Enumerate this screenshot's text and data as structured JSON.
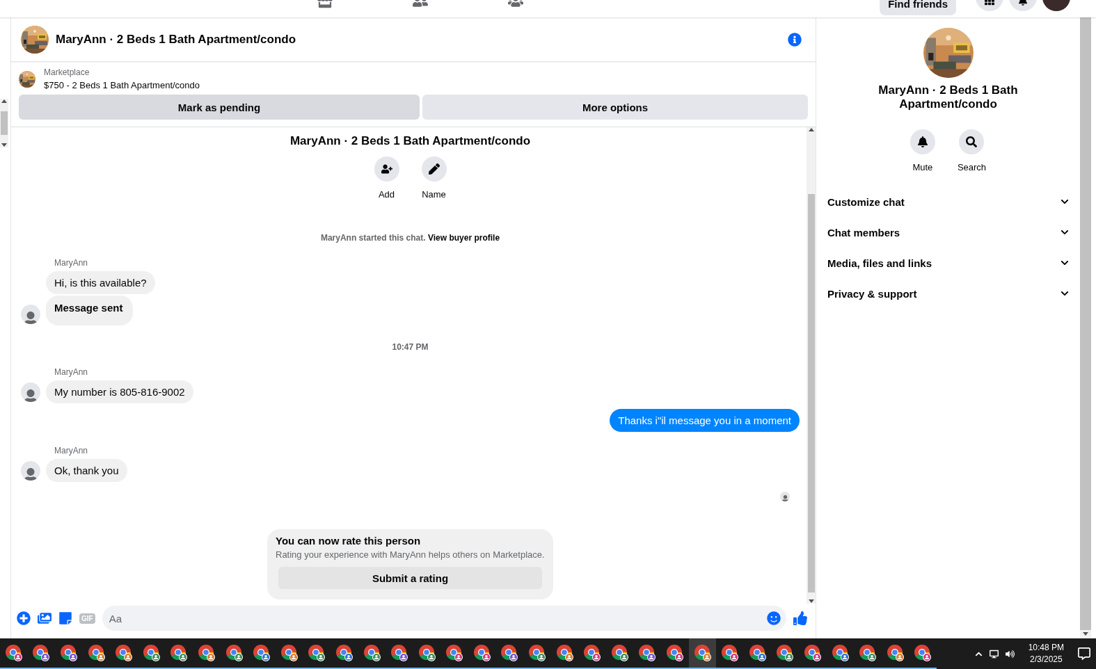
{
  "top_bar": {
    "find_friends": "Find friends"
  },
  "conversation": {
    "title": "MaryAnn · 2 Beds 1 Bath Apartment/condo"
  },
  "listing": {
    "source": "Marketplace",
    "summary": "$750 - 2 Beds 1 Bath Apartment/condo",
    "actions": [
      {
        "label": "Mark as pending",
        "hovered": true
      },
      {
        "label": "More options",
        "hovered": false
      }
    ]
  },
  "chat_intro": {
    "title": "MaryAnn · 2 Beds 1 Bath Apartment/condo",
    "actions": [
      {
        "label": "Add",
        "kind": "add"
      },
      {
        "label": "Name",
        "kind": "edit"
      }
    ],
    "notice": "MaryAnn started this chat.",
    "notice_link": "View buyer profile"
  },
  "messages": [
    {
      "kind": "incoming",
      "sender": "MaryAnn",
      "bubbles": [
        {
          "text": "Hi, is this available?",
          "kind": "text"
        },
        {
          "text": "Message sent",
          "kind": "status"
        }
      ]
    },
    {
      "kind": "time",
      "text": "10:47 PM"
    },
    {
      "kind": "incoming",
      "sender": "MaryAnn",
      "bubbles": [
        {
          "text": "My number is 805-816-9002",
          "kind": "text"
        }
      ]
    },
    {
      "kind": "outgoing",
      "bubbles": [
        {
          "text": "Thanks i\"il message you in a moment",
          "kind": "text"
        }
      ]
    },
    {
      "kind": "incoming",
      "sender": "MaryAnn",
      "bubbles": [
        {
          "text": "Ok, thank you",
          "kind": "text"
        }
      ]
    },
    {
      "kind": "seen"
    }
  ],
  "rating_card": {
    "title": "You can now rate this person",
    "text": "Rating your experience with MaryAnn helps others on Marketplace.",
    "button": "Submit a rating"
  },
  "composer": {
    "placeholder": "Aa",
    "gif_label": "GIF"
  },
  "details": {
    "title": "MaryAnn · 2 Beds 1 Bath Apartment/condo",
    "actions": [
      {
        "label": "Mute",
        "kind": "bell"
      },
      {
        "label": "Search",
        "kind": "search"
      }
    ],
    "sections": [
      {
        "label": "Customize chat",
        "expanded": false
      },
      {
        "label": "Chat members",
        "expanded": false
      },
      {
        "label": "Media, files and links",
        "expanded": false
      },
      {
        "label": "Privacy & support",
        "expanded": false
      }
    ]
  },
  "taskbar": {
    "apps": [
      {
        "color": "#d63384",
        "selected": false
      },
      {
        "color": "#7b4fd6",
        "selected": false
      },
      {
        "color": "#7b4fd6",
        "selected": false
      },
      {
        "color": "#e07a2a",
        "selected": false
      },
      {
        "color": "#e07a2a",
        "selected": false
      },
      {
        "color": "#3a8f5a",
        "selected": false
      },
      {
        "color": "#3a8f5a",
        "selected": false
      },
      {
        "color": "#e07a2a",
        "selected": false
      },
      {
        "color": "#3a8f5a",
        "selected": false
      },
      {
        "color": "#2a6fd6",
        "selected": false
      },
      {
        "color": "#e07a2a",
        "selected": false
      },
      {
        "color": "#3a8f5a",
        "selected": false
      },
      {
        "color": "#2a6fd6",
        "selected": false
      },
      {
        "color": "#3a8f5a",
        "selected": false
      },
      {
        "color": "#7b4fd6",
        "selected": false
      },
      {
        "color": "#3a8f5a",
        "selected": false
      },
      {
        "color": "#d63384",
        "selected": false
      },
      {
        "color": "#d63384",
        "selected": false
      },
      {
        "color": "#7b4fd6",
        "selected": false
      },
      {
        "color": "#3a8f5a",
        "selected": false
      },
      {
        "color": "#e07a2a",
        "selected": false
      },
      {
        "color": "#d63384",
        "selected": false
      },
      {
        "color": "#3a8f5a",
        "selected": false
      },
      {
        "color": "#7b4fd6",
        "selected": false
      },
      {
        "color": "#d63384",
        "selected": false
      },
      {
        "color": "#e07a2a",
        "selected": true
      },
      {
        "color": "#d63384",
        "selected": false
      },
      {
        "color": "#2a6fd6",
        "selected": false
      },
      {
        "color": "#3a8f5a",
        "selected": false
      },
      {
        "color": "#d63384",
        "selected": false
      },
      {
        "color": "#2a6fd6",
        "selected": false
      },
      {
        "color": "#3a8f5a",
        "selected": false
      },
      {
        "color": "#e07a2a",
        "selected": false
      },
      {
        "color": "#d63384",
        "selected": false
      }
    ],
    "time": "10:48 PM",
    "date": "2/3/2025"
  }
}
